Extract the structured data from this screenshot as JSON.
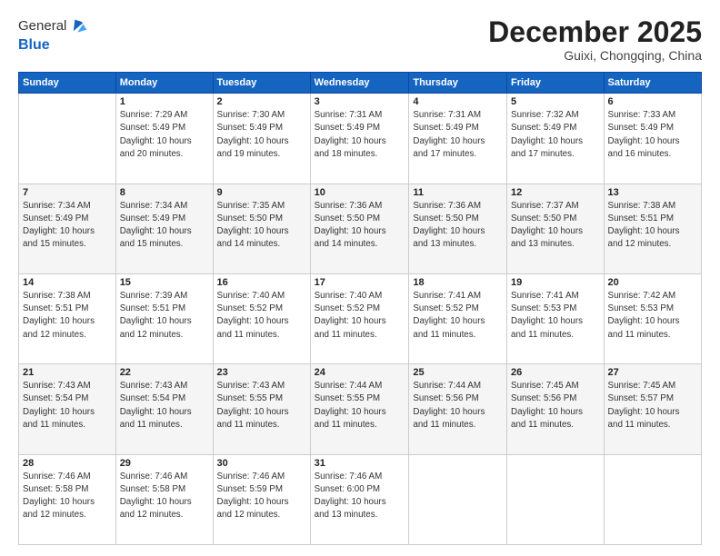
{
  "logo": {
    "general": "General",
    "blue": "Blue"
  },
  "header": {
    "month": "December 2025",
    "location": "Guixi, Chongqing, China"
  },
  "weekdays": [
    "Sunday",
    "Monday",
    "Tuesday",
    "Wednesday",
    "Thursday",
    "Friday",
    "Saturday"
  ],
  "weeks": [
    [
      {
        "day": "",
        "info": ""
      },
      {
        "day": "1",
        "info": "Sunrise: 7:29 AM\nSunset: 5:49 PM\nDaylight: 10 hours\nand 20 minutes."
      },
      {
        "day": "2",
        "info": "Sunrise: 7:30 AM\nSunset: 5:49 PM\nDaylight: 10 hours\nand 19 minutes."
      },
      {
        "day": "3",
        "info": "Sunrise: 7:31 AM\nSunset: 5:49 PM\nDaylight: 10 hours\nand 18 minutes."
      },
      {
        "day": "4",
        "info": "Sunrise: 7:31 AM\nSunset: 5:49 PM\nDaylight: 10 hours\nand 17 minutes."
      },
      {
        "day": "5",
        "info": "Sunrise: 7:32 AM\nSunset: 5:49 PM\nDaylight: 10 hours\nand 17 minutes."
      },
      {
        "day": "6",
        "info": "Sunrise: 7:33 AM\nSunset: 5:49 PM\nDaylight: 10 hours\nand 16 minutes."
      }
    ],
    [
      {
        "day": "7",
        "info": "Sunrise: 7:34 AM\nSunset: 5:49 PM\nDaylight: 10 hours\nand 15 minutes."
      },
      {
        "day": "8",
        "info": "Sunrise: 7:34 AM\nSunset: 5:49 PM\nDaylight: 10 hours\nand 15 minutes."
      },
      {
        "day": "9",
        "info": "Sunrise: 7:35 AM\nSunset: 5:50 PM\nDaylight: 10 hours\nand 14 minutes."
      },
      {
        "day": "10",
        "info": "Sunrise: 7:36 AM\nSunset: 5:50 PM\nDaylight: 10 hours\nand 14 minutes."
      },
      {
        "day": "11",
        "info": "Sunrise: 7:36 AM\nSunset: 5:50 PM\nDaylight: 10 hours\nand 13 minutes."
      },
      {
        "day": "12",
        "info": "Sunrise: 7:37 AM\nSunset: 5:50 PM\nDaylight: 10 hours\nand 13 minutes."
      },
      {
        "day": "13",
        "info": "Sunrise: 7:38 AM\nSunset: 5:51 PM\nDaylight: 10 hours\nand 12 minutes."
      }
    ],
    [
      {
        "day": "14",
        "info": "Sunrise: 7:38 AM\nSunset: 5:51 PM\nDaylight: 10 hours\nand 12 minutes."
      },
      {
        "day": "15",
        "info": "Sunrise: 7:39 AM\nSunset: 5:51 PM\nDaylight: 10 hours\nand 12 minutes."
      },
      {
        "day": "16",
        "info": "Sunrise: 7:40 AM\nSunset: 5:52 PM\nDaylight: 10 hours\nand 11 minutes."
      },
      {
        "day": "17",
        "info": "Sunrise: 7:40 AM\nSunset: 5:52 PM\nDaylight: 10 hours\nand 11 minutes."
      },
      {
        "day": "18",
        "info": "Sunrise: 7:41 AM\nSunset: 5:52 PM\nDaylight: 10 hours\nand 11 minutes."
      },
      {
        "day": "19",
        "info": "Sunrise: 7:41 AM\nSunset: 5:53 PM\nDaylight: 10 hours\nand 11 minutes."
      },
      {
        "day": "20",
        "info": "Sunrise: 7:42 AM\nSunset: 5:53 PM\nDaylight: 10 hours\nand 11 minutes."
      }
    ],
    [
      {
        "day": "21",
        "info": "Sunrise: 7:43 AM\nSunset: 5:54 PM\nDaylight: 10 hours\nand 11 minutes."
      },
      {
        "day": "22",
        "info": "Sunrise: 7:43 AM\nSunset: 5:54 PM\nDaylight: 10 hours\nand 11 minutes."
      },
      {
        "day": "23",
        "info": "Sunrise: 7:43 AM\nSunset: 5:55 PM\nDaylight: 10 hours\nand 11 minutes."
      },
      {
        "day": "24",
        "info": "Sunrise: 7:44 AM\nSunset: 5:55 PM\nDaylight: 10 hours\nand 11 minutes."
      },
      {
        "day": "25",
        "info": "Sunrise: 7:44 AM\nSunset: 5:56 PM\nDaylight: 10 hours\nand 11 minutes."
      },
      {
        "day": "26",
        "info": "Sunrise: 7:45 AM\nSunset: 5:56 PM\nDaylight: 10 hours\nand 11 minutes."
      },
      {
        "day": "27",
        "info": "Sunrise: 7:45 AM\nSunset: 5:57 PM\nDaylight: 10 hours\nand 11 minutes."
      }
    ],
    [
      {
        "day": "28",
        "info": "Sunrise: 7:46 AM\nSunset: 5:58 PM\nDaylight: 10 hours\nand 12 minutes."
      },
      {
        "day": "29",
        "info": "Sunrise: 7:46 AM\nSunset: 5:58 PM\nDaylight: 10 hours\nand 12 minutes."
      },
      {
        "day": "30",
        "info": "Sunrise: 7:46 AM\nSunset: 5:59 PM\nDaylight: 10 hours\nand 12 minutes."
      },
      {
        "day": "31",
        "info": "Sunrise: 7:46 AM\nSunset: 6:00 PM\nDaylight: 10 hours\nand 13 minutes."
      },
      {
        "day": "",
        "info": ""
      },
      {
        "day": "",
        "info": ""
      },
      {
        "day": "",
        "info": ""
      }
    ]
  ]
}
